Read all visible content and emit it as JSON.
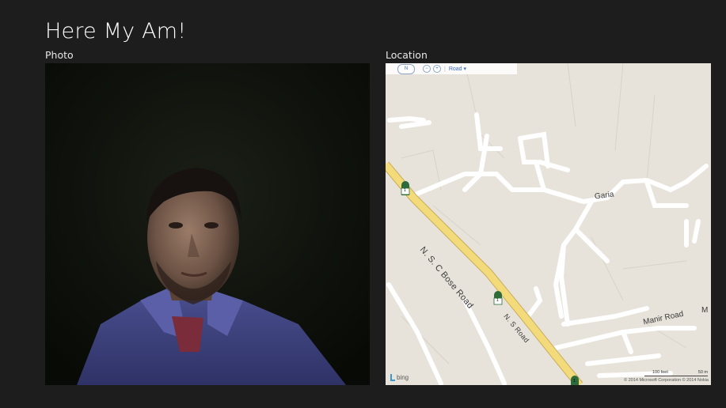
{
  "app": {
    "title": "Here My Am!"
  },
  "photo": {
    "label": "Photo"
  },
  "location": {
    "label": "Location",
    "toolbar": {
      "compass_label": "N",
      "zoom_out_label": "−",
      "zoom_in_label": "+",
      "divider": "|",
      "map_style": "Road ▾"
    },
    "places": {
      "garia": "Garia",
      "manir_road": "Manir Road",
      "m_partial": "M",
      "nsc_bose_road": "N. S. C Bose Road",
      "ns_road": "N. S Road"
    },
    "road_shields": [
      "1",
      "1",
      "1"
    ],
    "brand": "bing",
    "scale": {
      "feet": "100 feet",
      "meters": "50 m"
    },
    "copyright": "© 2014 Microsoft Corporation   © 2014 Nokia"
  },
  "colors": {
    "background": "#1d1d1d",
    "map_land": "#e7e3da",
    "map_road_major": "#f0d677",
    "map_road_minor": "#ffffff"
  }
}
